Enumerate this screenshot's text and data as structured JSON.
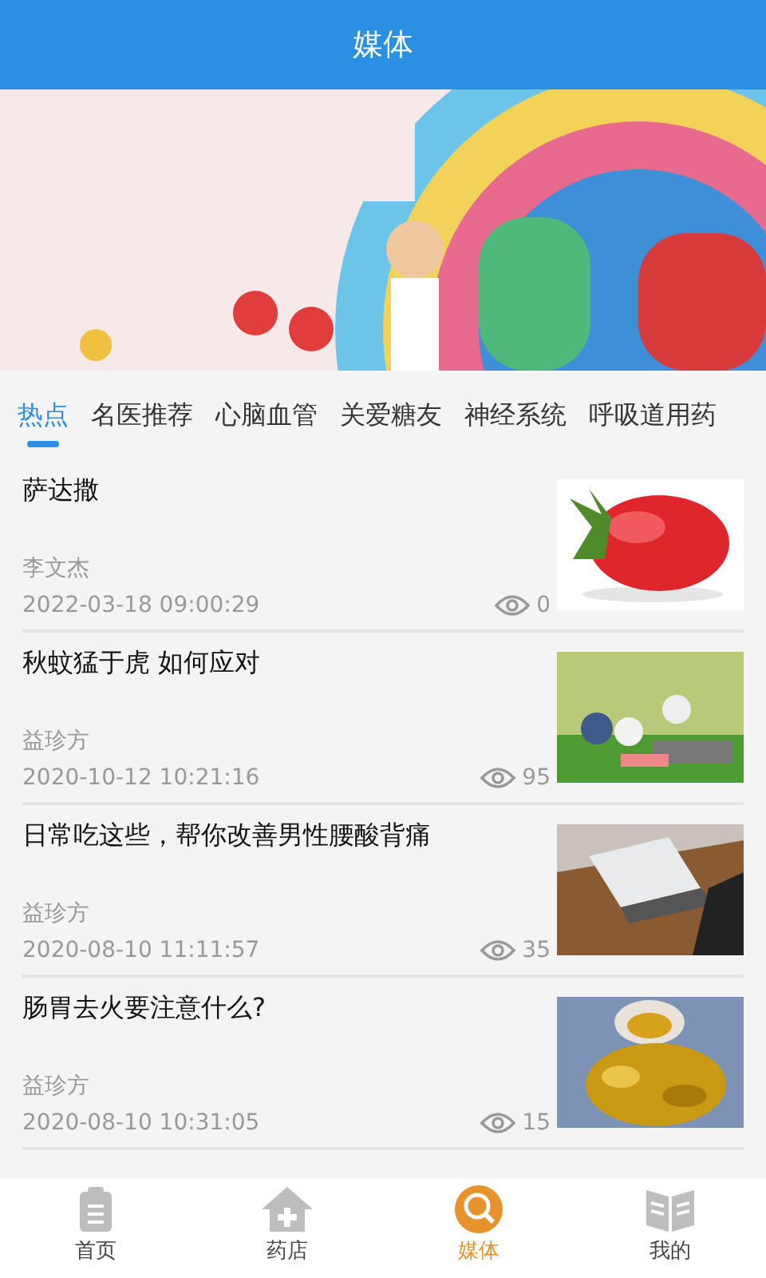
{
  "header": {
    "title": "媒体"
  },
  "tabs": [
    {
      "label": "热点",
      "selected": true
    },
    {
      "label": "名医推荐",
      "selected": false
    },
    {
      "label": "心脑血管",
      "selected": false
    },
    {
      "label": "关爱糖友",
      "selected": false
    },
    {
      "label": "神经系统",
      "selected": false
    },
    {
      "label": "呼吸道用药",
      "selected": false
    }
  ],
  "articles": [
    {
      "title": "萨达撒",
      "author": "李文杰",
      "date": "2022-03-18 09:00:29",
      "views": "0"
    },
    {
      "title": "秋蚊猛于虎 如何应对",
      "author": "益珍方",
      "date": "2020-10-12 10:21:16",
      "views": "95"
    },
    {
      "title": "日常吃这些，帮你改善男性腰酸背痛",
      "author": "益珍方",
      "date": "2020-08-10 11:11:57",
      "views": "35"
    },
    {
      "title": "肠胃去火要注意什么?",
      "author": "益珍方",
      "date": "2020-08-10 10:31:05",
      "views": "15"
    }
  ],
  "nav": [
    {
      "label": "首页",
      "selected": false
    },
    {
      "label": "药店",
      "selected": false
    },
    {
      "label": "媒体",
      "selected": true
    },
    {
      "label": "我的",
      "selected": false
    }
  ]
}
